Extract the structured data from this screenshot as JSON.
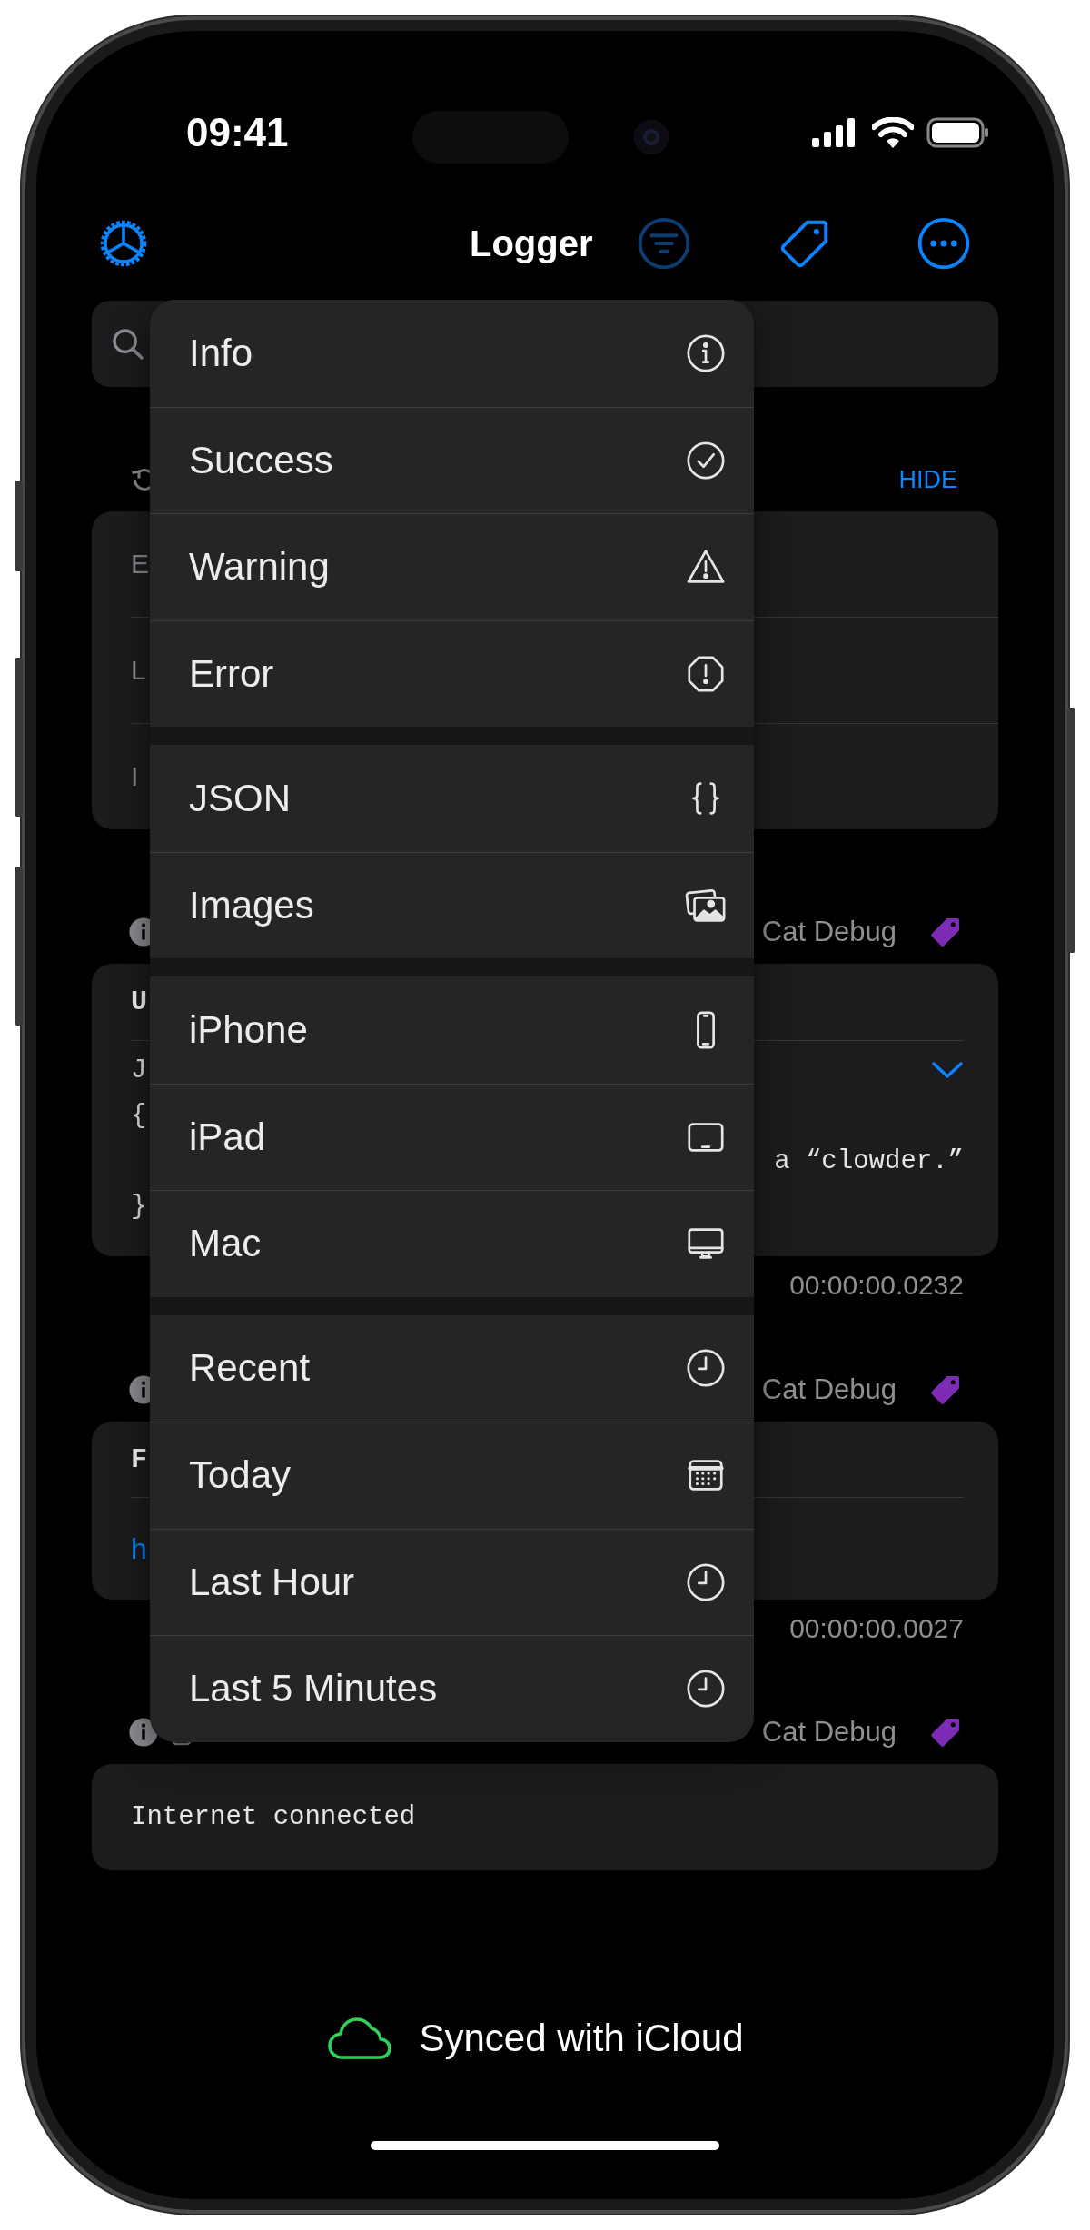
{
  "status_bar": {
    "time": "09:41"
  },
  "nav": {
    "title": "Logger"
  },
  "section": {
    "action": "HIDE"
  },
  "filter_rows": [
    {
      "label": "E"
    },
    {
      "label": "L"
    },
    {
      "label": "I"
    }
  ],
  "entries": [
    {
      "kind": "json",
      "source": "Cat Debug",
      "title": "U",
      "lines": [
        {
          "text": "J",
          "trailing": false
        },
        {
          "text": "{",
          "trailing": false
        },
        {
          "text": "a “clowder.”",
          "trailing": true
        },
        {
          "text": "}",
          "trailing": false
        }
      ],
      "duration": "00:00:00.0232"
    },
    {
      "kind": "link",
      "source": "Cat Debug",
      "title": "F",
      "link": "h",
      "duration": "00:00:00.0027"
    },
    {
      "kind": "plain",
      "source": "Cat Debug",
      "message": "Internet connected"
    }
  ],
  "menu": {
    "groups": [
      [
        {
          "label": "Info"
        },
        {
          "label": "Success"
        },
        {
          "label": "Warning"
        },
        {
          "label": "Error"
        }
      ],
      [
        {
          "label": "JSON"
        },
        {
          "label": "Images"
        }
      ],
      [
        {
          "label": "iPhone"
        },
        {
          "label": "iPad"
        },
        {
          "label": "Mac"
        }
      ],
      [
        {
          "label": "Recent"
        },
        {
          "label": "Today"
        },
        {
          "label": "Last Hour"
        },
        {
          "label": "Last 5 Minutes"
        }
      ]
    ]
  },
  "footer": {
    "sync": "Synced with iCloud"
  }
}
